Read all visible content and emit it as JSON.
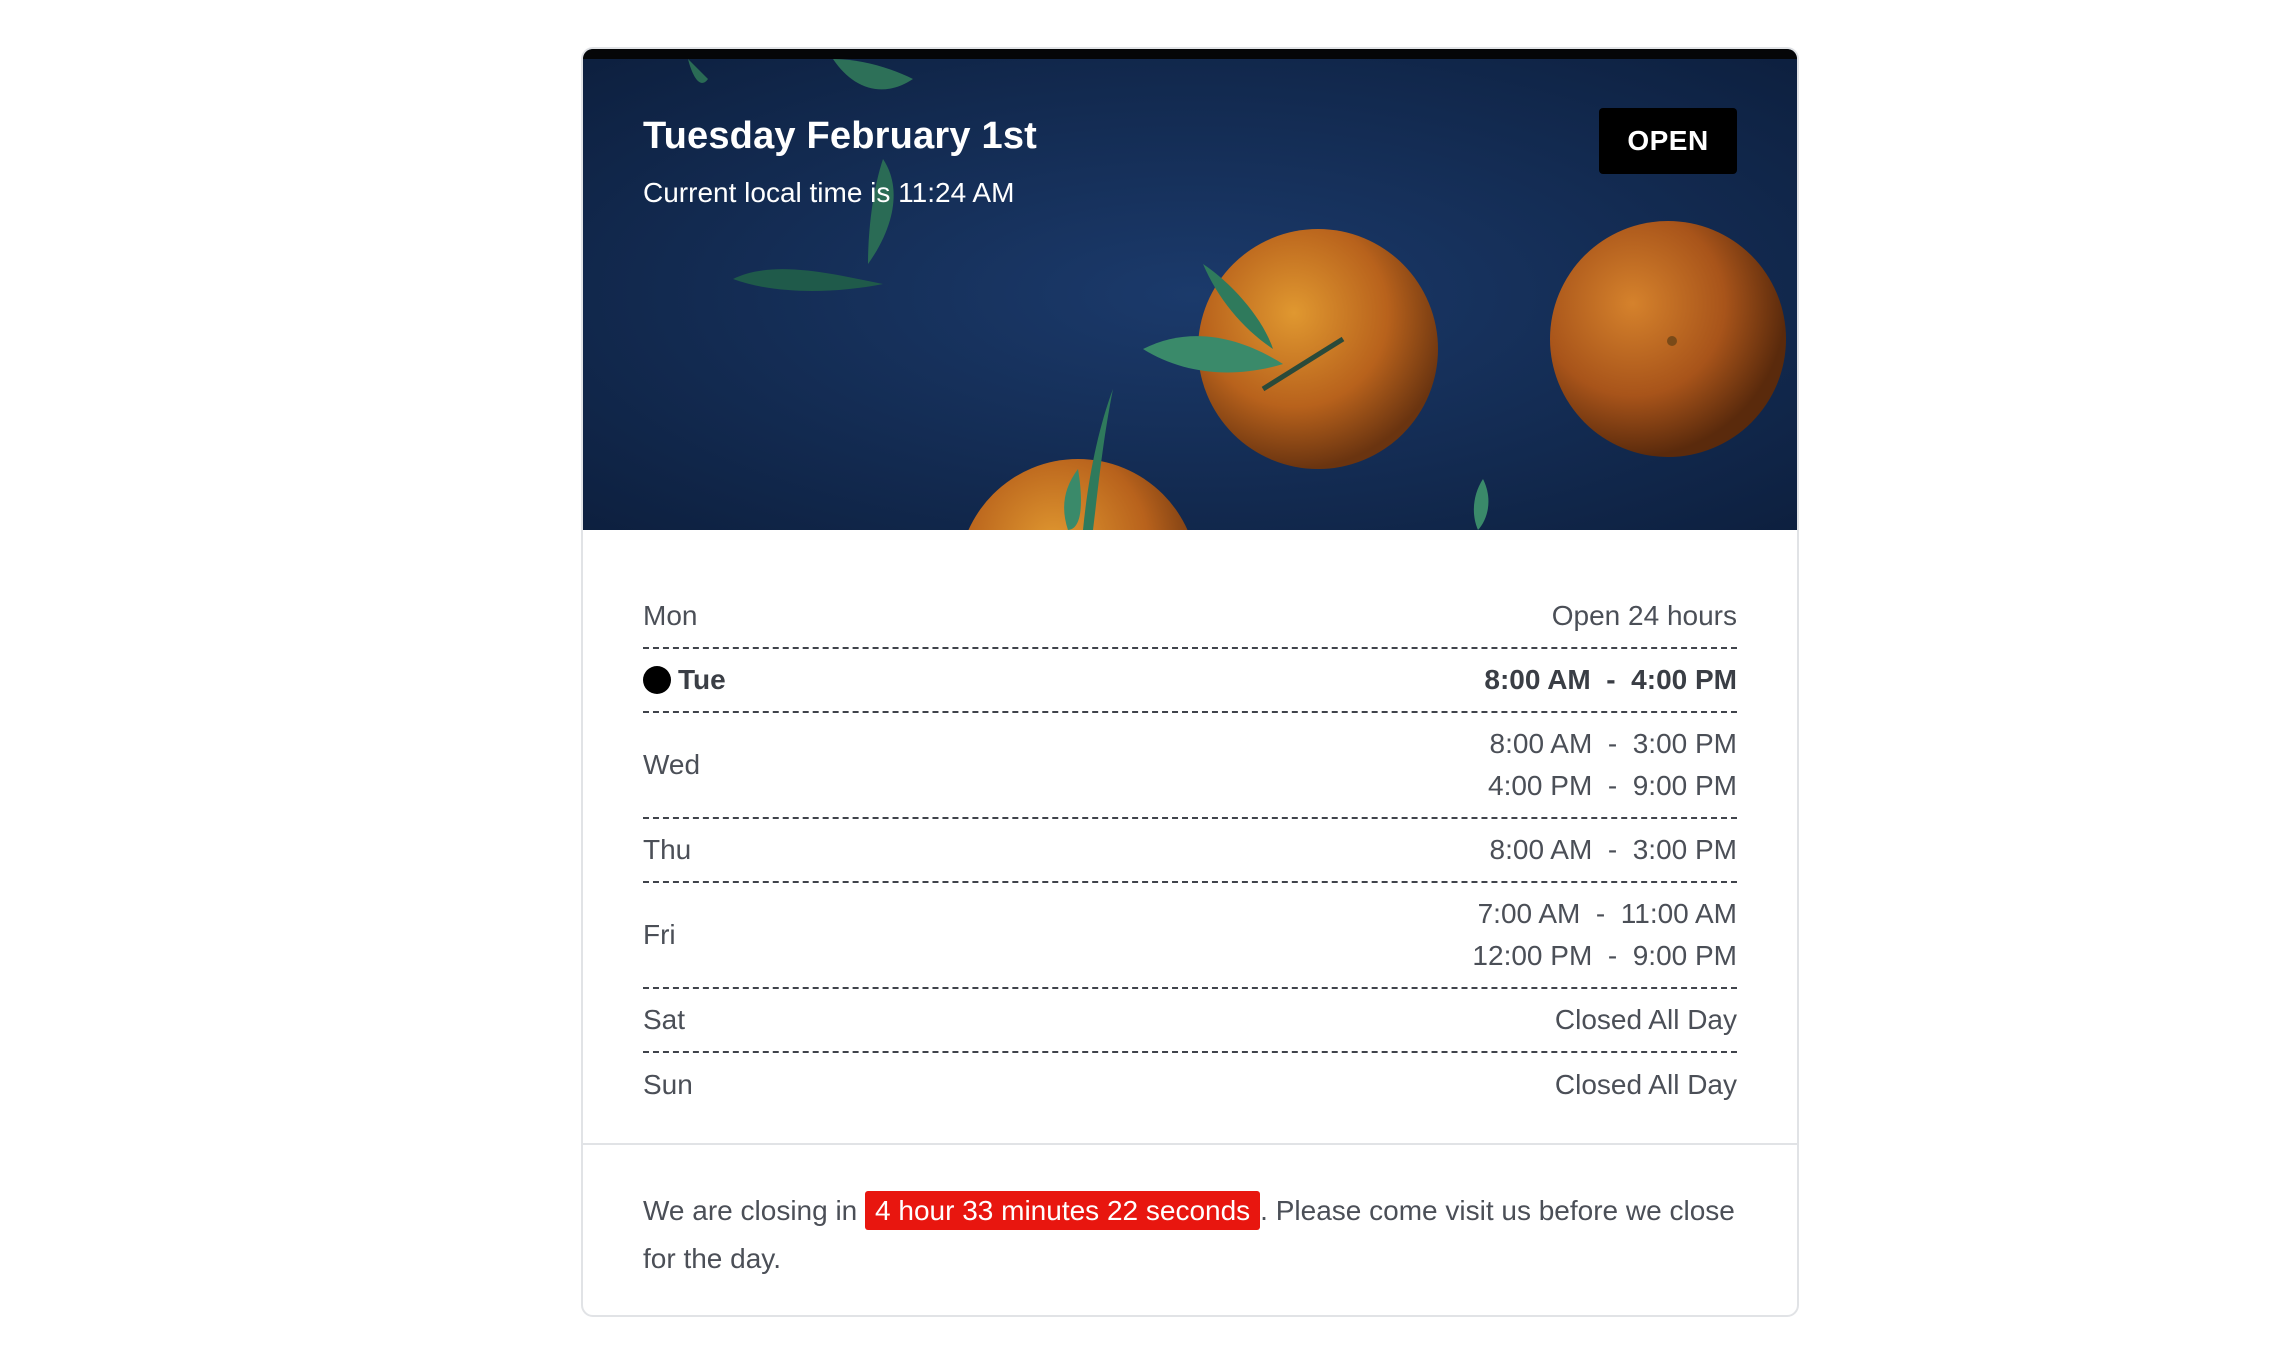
{
  "header": {
    "date": "Tuesday February 1st",
    "local_time": "Current local time is 11:24 AM",
    "status": "OPEN"
  },
  "hours": [
    {
      "day": "Mon",
      "times": [
        "Open 24 hours"
      ]
    },
    {
      "day": "Tue",
      "times": [
        "8:00 AM  -  4:00 PM"
      ],
      "today": true
    },
    {
      "day": "Wed",
      "times": [
        "8:00 AM  -  3:00 PM",
        "4:00 PM  -  9:00 PM"
      ]
    },
    {
      "day": "Thu",
      "times": [
        "8:00 AM  -  3:00 PM"
      ]
    },
    {
      "day": "Fri",
      "times": [
        "7:00 AM  -  11:00 AM",
        "12:00 PM  -  9:00 PM"
      ]
    },
    {
      "day": "Sat",
      "times": [
        "Closed All Day"
      ]
    },
    {
      "day": "Sun",
      "times": [
        "Closed All Day"
      ]
    }
  ],
  "footer": {
    "prefix": "We are closing in ",
    "countdown": "4 hour 33 minutes 22 seconds",
    "suffix": ". Please come visit us before we close for the day."
  },
  "colors": {
    "badge_bg": "#000000",
    "countdown_bg": "#e8160f",
    "today_dot": "#000000"
  },
  "icons": {
    "today_indicator": "filled-circle-icon"
  }
}
